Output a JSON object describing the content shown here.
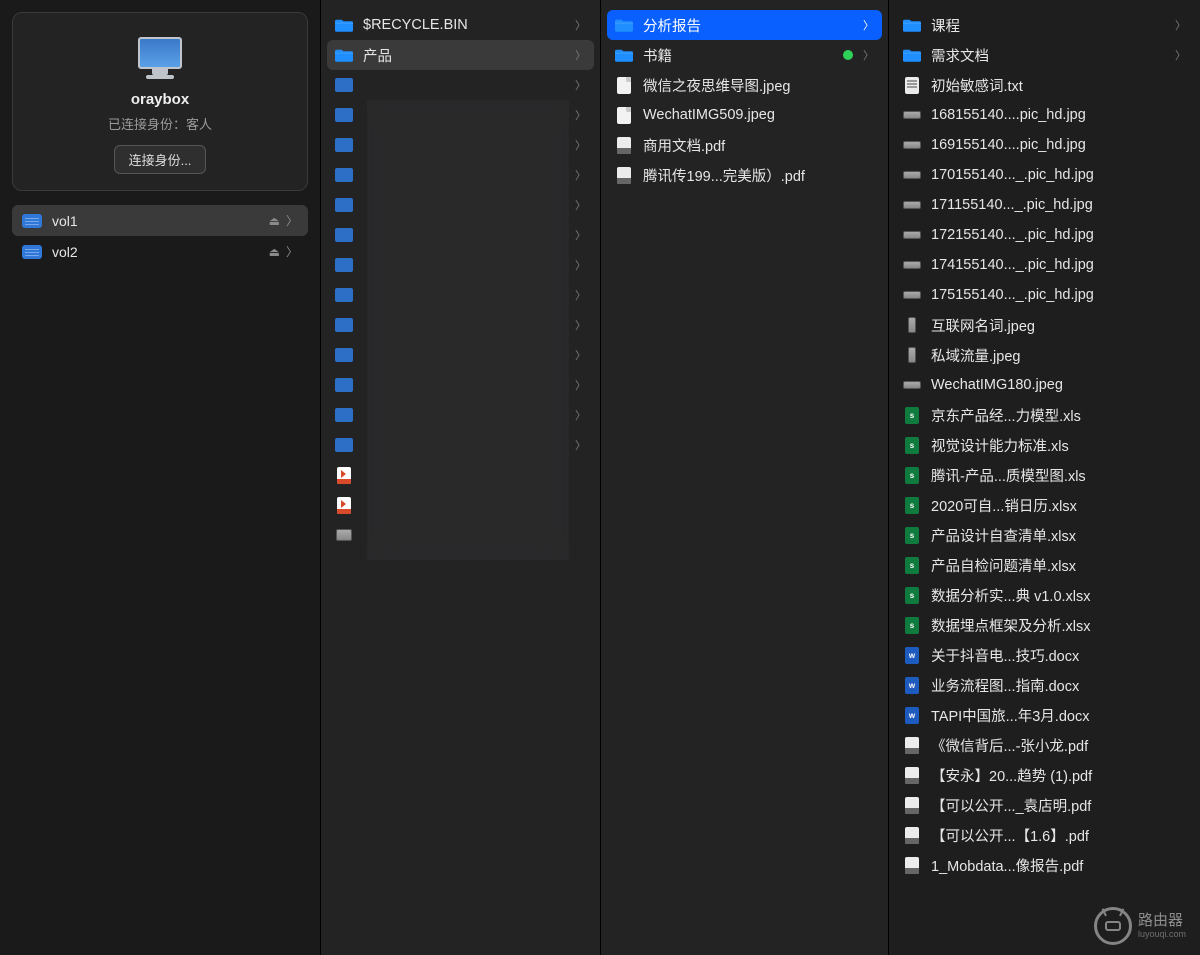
{
  "server": {
    "name": "oraybox",
    "status": "已连接身份：客人",
    "connect_label": "连接身份..."
  },
  "volumes": [
    {
      "name": "vol1",
      "selected": true
    },
    {
      "name": "vol2",
      "selected": false
    }
  ],
  "column1": {
    "items": [
      {
        "type": "folder",
        "label": "$RECYCLE.BIN",
        "hasChildren": true
      },
      {
        "type": "folder",
        "label": "产品",
        "hasChildren": true,
        "highlight": true
      }
    ],
    "blurred_folder_count": 13,
    "blurred_files": [
      {
        "type": "flv"
      },
      {
        "type": "flv"
      },
      {
        "type": "img"
      }
    ]
  },
  "column2": {
    "items": [
      {
        "type": "folder",
        "label": "分析报告",
        "hasChildren": true,
        "selected": true
      },
      {
        "type": "folder",
        "label": "书籍",
        "hasChildren": true,
        "tag": "green"
      },
      {
        "type": "image",
        "label": "微信之夜思维导图.jpeg"
      },
      {
        "type": "image",
        "label": "WechatIMG509.jpeg"
      },
      {
        "type": "pdf",
        "label": "商用文档.pdf"
      },
      {
        "type": "pdf",
        "label": "腾讯传199...完美版）.pdf"
      }
    ]
  },
  "column3": {
    "items": [
      {
        "type": "folder",
        "label": "课程",
        "hasChildren": true
      },
      {
        "type": "folder",
        "label": "需求文档",
        "hasChildren": true
      },
      {
        "type": "txt",
        "label": "初始敏感词.txt"
      },
      {
        "type": "img-wide",
        "label": "168155140....pic_hd.jpg"
      },
      {
        "type": "img-wide",
        "label": "169155140....pic_hd.jpg"
      },
      {
        "type": "img-wide",
        "label": "170155140..._.pic_hd.jpg"
      },
      {
        "type": "img-wide",
        "label": "171155140..._.pic_hd.jpg"
      },
      {
        "type": "img-wide",
        "label": "172155140..._.pic_hd.jpg"
      },
      {
        "type": "img-wide",
        "label": "174155140..._.pic_hd.jpg"
      },
      {
        "type": "img-wide",
        "label": "175155140..._.pic_hd.jpg"
      },
      {
        "type": "img-tall",
        "label": "互联网名词.jpeg"
      },
      {
        "type": "img-tall",
        "label": "私域流量.jpeg"
      },
      {
        "type": "img-wide",
        "label": "WechatIMG180.jpeg"
      },
      {
        "type": "xls",
        "label": "京东产品经...力模型.xls"
      },
      {
        "type": "xls",
        "label": "视觉设计能力标准.xls"
      },
      {
        "type": "xls",
        "label": "腾讯-产品...质模型图.xls"
      },
      {
        "type": "xls",
        "label": "2020可自...销日历.xlsx"
      },
      {
        "type": "xls",
        "label": "产品设计自查清单.xlsx"
      },
      {
        "type": "xls",
        "label": "产品自检问题清单.xlsx"
      },
      {
        "type": "xls",
        "label": "数据分析实...典 v1.0.xlsx"
      },
      {
        "type": "xls",
        "label": "数据埋点框架及分析.xlsx"
      },
      {
        "type": "doc",
        "label": "关于抖音电...技巧.docx"
      },
      {
        "type": "doc",
        "label": "业务流程图...指南.docx"
      },
      {
        "type": "doc",
        "label": "TAPI中国旅...年3月.docx"
      },
      {
        "type": "pdf",
        "label": "《微信背后...-张小龙.pdf"
      },
      {
        "type": "pdf",
        "label": "【安永】20...趋势 (1).pdf"
      },
      {
        "type": "pdf",
        "label": "【可以公开..._袁店明.pdf"
      },
      {
        "type": "pdf",
        "label": "【可以公开...【1.6】.pdf"
      },
      {
        "type": "pdf",
        "label": "1_Mobdata...像报告.pdf"
      }
    ]
  },
  "watermark": {
    "title": "路由器",
    "sub": "luyouqi.com"
  }
}
